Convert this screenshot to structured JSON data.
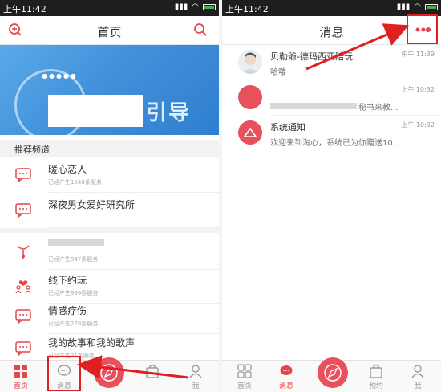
{
  "status": {
    "time": "上午11:42"
  },
  "left": {
    "nav_title": "首页",
    "section_title": "推荐频道",
    "banner_text": "引导",
    "channels": [
      {
        "title": "暖心恋人",
        "sub": "已经产生1548条服务"
      },
      {
        "title": "深夜男女爱好研究所",
        "sub": ""
      },
      {
        "title": "",
        "sub": ""
      },
      {
        "title": "",
        "sub": "已经产生947条服务"
      },
      {
        "title": "线下约玩",
        "sub": "已经产生999条服务"
      },
      {
        "title": "情感疗伤",
        "sub": "已经产生278条服务"
      },
      {
        "title": "我的故事和我的歌声",
        "sub": "已经产生31条服务"
      }
    ],
    "tabs": [
      {
        "label": "首页"
      },
      {
        "label": "消息"
      },
      {
        "label": ""
      },
      {
        "label": ""
      },
      {
        "label": "我"
      }
    ]
  },
  "right": {
    "nav_title": "消息",
    "messages": [
      {
        "name": "贝勒爺-德玛西亚陪玩",
        "preview": "哈喽",
        "time": "中午 11:39"
      },
      {
        "name": "",
        "preview": "秘书来教...",
        "time": "上午 10:32"
      },
      {
        "name": "系统通知",
        "preview": "欢迎来到淘心，系统已为你赠送10...",
        "time": "上午 10:32"
      }
    ],
    "tabs": [
      {
        "label": "首页"
      },
      {
        "label": "消息"
      },
      {
        "label": ""
      },
      {
        "label": "预约"
      },
      {
        "label": "我"
      }
    ]
  },
  "colors": {
    "accent": "#e5454c",
    "banner": "#3f8fd9",
    "highlight": "#e02020"
  }
}
